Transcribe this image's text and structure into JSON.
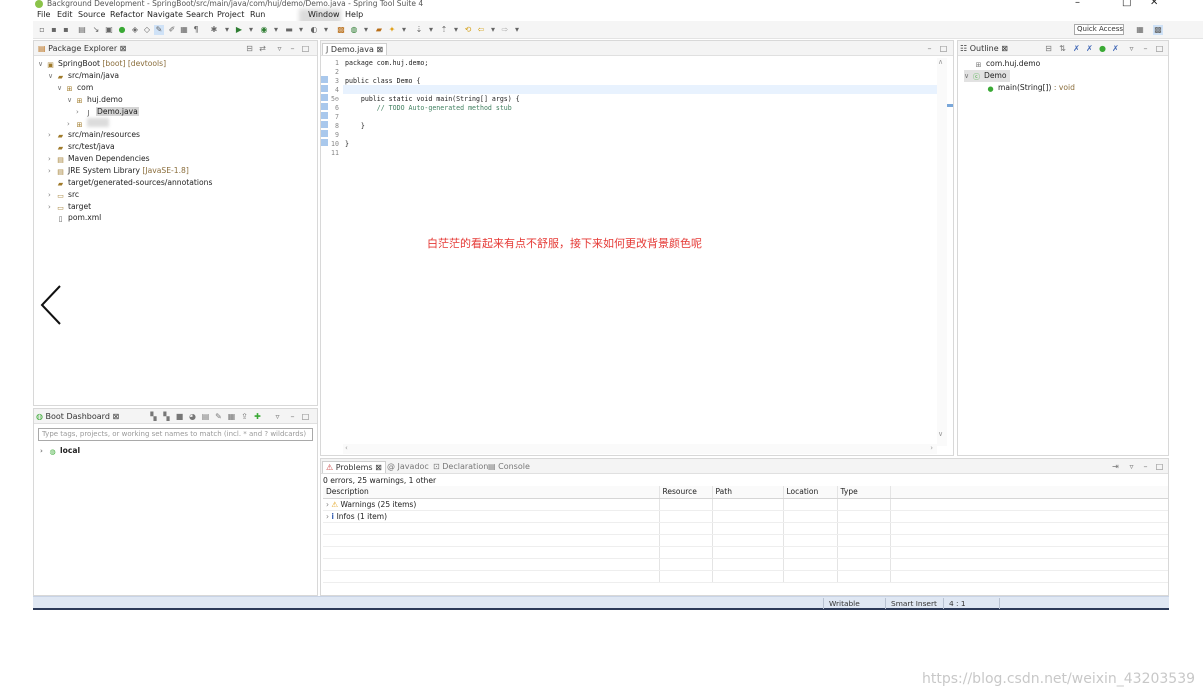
{
  "window": {
    "title": "Background Development - SpringBoot/src/main/java/com/huj/demo/Demo.java - Spring Tool Suite 4",
    "minimize": "–",
    "maximize": "□",
    "close": "✕"
  },
  "menu": [
    "File",
    "Edit",
    "Source",
    "Refactor",
    "Navigate",
    "Search",
    "Project",
    "Run",
    "Window",
    "Help"
  ],
  "toolbar": {
    "quick_access": "Quick Access"
  },
  "package_explorer": {
    "tab_label": "Package Explorer",
    "tree": [
      {
        "label": "SpringBoot",
        "extra": " [boot] [devtools]",
        "depth": 0,
        "expanded": true
      },
      {
        "label": "src/main/java",
        "extra": "",
        "depth": 1,
        "expanded": true
      },
      {
        "label": "com",
        "extra": "",
        "depth": 2,
        "expanded": true
      },
      {
        "label": "huj.demo",
        "extra": "",
        "depth": 3,
        "expanded": true
      },
      {
        "label": "Demo.java",
        "extra": "",
        "depth": 4,
        "expanded": false
      },
      {
        "label": "",
        "extra": "",
        "depth": 3,
        "expanded": false
      },
      {
        "label": "src/main/resources",
        "extra": "",
        "depth": 1,
        "expanded": false
      },
      {
        "label": "src/test/java",
        "extra": "",
        "depth": 1,
        "expanded": false
      },
      {
        "label": "Maven Dependencies",
        "extra": "",
        "depth": 1,
        "expanded": false
      },
      {
        "label": "JRE System Library",
        "extra": " [JavaSE-1.8]",
        "depth": 1,
        "expanded": false
      },
      {
        "label": "target/generated-sources/annotations",
        "extra": "",
        "depth": 1,
        "expanded": false
      },
      {
        "label": "src",
        "extra": "",
        "depth": 1,
        "expanded": false
      },
      {
        "label": "target",
        "extra": "",
        "depth": 1,
        "expanded": false
      },
      {
        "label": "pom.xml",
        "extra": "",
        "depth": 1,
        "expanded": false
      }
    ]
  },
  "boot_dashboard": {
    "tab_label": "Boot Dashboard",
    "search_placeholder": "Type tags, projects, or working set names to match (incl. * and ? wildcards)",
    "item": "local"
  },
  "editor": {
    "tab_label": "Demo.java",
    "lines": [
      "package com.huj.demo;",
      "",
      "public class Demo {",
      "",
      "    public static void main(String[] args) {",
      "        // TODO Auto-generated method stub",
      "",
      "    }",
      "",
      "}",
      ""
    ]
  },
  "outline": {
    "tab_label": "Outline",
    "package": "com.huj.demo",
    "class": "Demo",
    "method": "main(String[])",
    "method_type": " : void"
  },
  "bottom_tabs": {
    "problems": "Problems",
    "javadoc": "Javadoc",
    "declaration": "Declaration",
    "console": "Console"
  },
  "problems": {
    "summary": "0 errors, 25 warnings, 1 other",
    "columns": [
      "Description",
      "Resource",
      "Path",
      "Location",
      "Type"
    ],
    "rows": [
      {
        "label": "Warnings (25 items)"
      },
      {
        "label": "Infos (1 item)"
      }
    ]
  },
  "status": {
    "writable": "Writable",
    "insert_mode": "Smart Insert",
    "position": "4 : 1"
  },
  "annotation": "白茫茫的看起来有点不舒服，接下来如何更改背景颜色呢",
  "watermark": "https://blog.csdn.net/weixin_43203539"
}
